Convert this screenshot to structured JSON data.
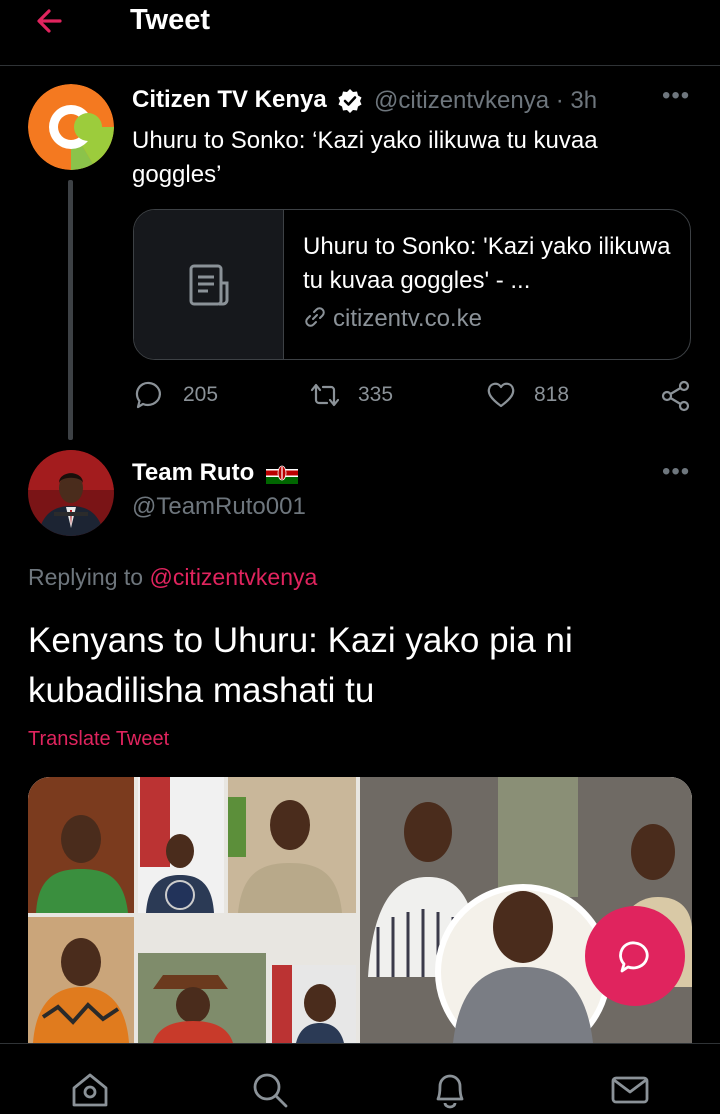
{
  "header": {
    "back_icon": "arrow-left-icon",
    "title": "Tweet",
    "accent_color": "#e0245e"
  },
  "original_tweet": {
    "author_name": "Citizen TV Kenya",
    "verified_icon": "verified-badge-icon",
    "handle_time": "@citizentvkenya · 3h",
    "more_icon": "more-dots-icon",
    "text": "Uhuru to Sonko: ‘Kazi yako ilikuwa tu kuvaa goggles’",
    "link_card": {
      "thumb_icon": "document-icon",
      "title": "Uhuru to Sonko: 'Kazi yako ilikuwa tu kuvaa goggles' - ...",
      "domain": "citizentv.co.ke"
    },
    "actions": {
      "replies": "205",
      "retweets": "335",
      "likes": "818",
      "share_icon": "share-icon"
    }
  },
  "reply_tweet": {
    "author_name": "Team Ruto",
    "flag_icon": "kenya-flag-icon",
    "handle": "@TeamRuto001",
    "more_icon": "more-dots-icon",
    "replying_prefix": "Replying to",
    "replying_to": "@citizentvkenya",
    "text": "Kenyans to Uhuru: Kazi yako pia ni kubadilisha mashati tu",
    "translate_label": "Translate Tweet",
    "media": "photo-collage"
  },
  "fab": {
    "icon": "compose-reply-icon"
  },
  "tabbar": {
    "items": [
      "home-icon",
      "search-icon",
      "notifications-icon",
      "messages-icon"
    ]
  }
}
